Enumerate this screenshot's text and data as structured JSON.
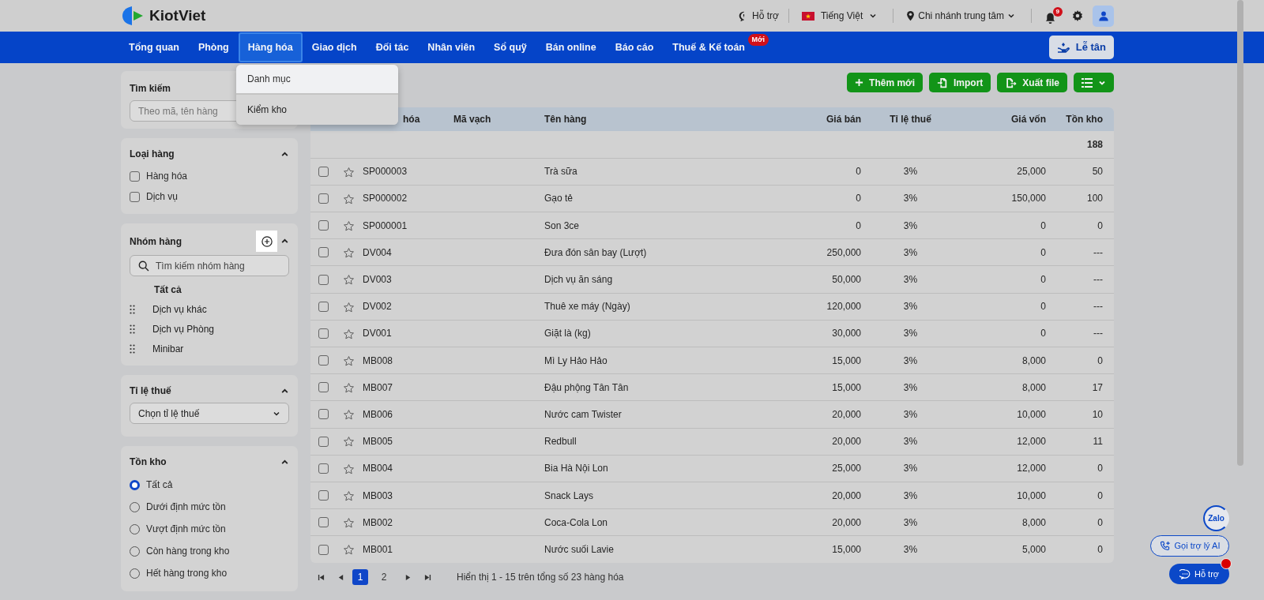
{
  "header": {
    "logo": "KiotViet",
    "support": "Hỗ trợ",
    "language": "Tiếng Việt",
    "branch": "Chi nhánh trung tâm",
    "notification_count": "9"
  },
  "nav": {
    "items": [
      {
        "label": "Tổng quan",
        "selected": false
      },
      {
        "label": "Phòng",
        "selected": false
      },
      {
        "label": "Hàng hóa",
        "selected": true
      },
      {
        "label": "Giao dịch",
        "selected": false
      },
      {
        "label": "Đối tác",
        "selected": false
      },
      {
        "label": "Nhân viên",
        "selected": false
      },
      {
        "label": "Sổ quỹ",
        "selected": false
      },
      {
        "label": "Bán online",
        "selected": false
      },
      {
        "label": "Báo cáo",
        "selected": false
      },
      {
        "label": "Thuế & Kế toán",
        "selected": false,
        "badge": "Mới"
      }
    ],
    "reception_button": "Lễ tân"
  },
  "dropdown": {
    "items": [
      {
        "label": "Danh mục",
        "selected": true
      },
      {
        "label": "Kiểm kho",
        "selected": false
      }
    ]
  },
  "sidebar": {
    "search": {
      "title": "Tìm kiếm",
      "placeholder": "Theo mã, tên hàng"
    },
    "product_type": {
      "title": "Loại hàng",
      "expanded": true,
      "options": [
        {
          "label": "Hàng hóa",
          "checked": false
        },
        {
          "label": "Dịch vụ",
          "checked": false
        }
      ]
    },
    "product_group": {
      "title": "Nhóm hàng",
      "expanded": true,
      "search_placeholder": "Tìm kiếm nhóm hàng",
      "items": [
        {
          "label": "Tất cả",
          "kind": "all",
          "selected": true
        },
        {
          "label": "Dịch vụ khác",
          "kind": "group",
          "selected": false
        },
        {
          "label": "Dịch vụ Phòng",
          "kind": "group",
          "selected": false
        },
        {
          "label": "Minibar",
          "kind": "group",
          "selected": false
        }
      ]
    },
    "tax_rate": {
      "title": "Tỉ lệ thuế",
      "expanded": true,
      "placeholder": "Chọn tỉ lệ thuế"
    },
    "stock": {
      "title": "Tồn kho",
      "expanded": true,
      "options": [
        {
          "label": "Tất cả",
          "selected": true
        },
        {
          "label": "Dưới định mức tồn",
          "selected": false
        },
        {
          "label": "Vượt định mức tồn",
          "selected": false
        },
        {
          "label": "Còn hàng trong kho",
          "selected": false
        },
        {
          "label": "Hết hàng trong kho",
          "selected": false
        }
      ]
    }
  },
  "toolbar": {
    "buttons": [
      {
        "label": "Thêm mới",
        "kind": "add"
      },
      {
        "label": "Import",
        "kind": "import"
      },
      {
        "label": "Xuất file",
        "kind": "export"
      }
    ]
  },
  "table": {
    "columns": [
      "hóa",
      "Mã vạch",
      "Tên hàng",
      "Giá bán",
      "Tỉ lệ thuế",
      "Giá vốn",
      "Tồn kho"
    ],
    "total_stock": "188",
    "rows": [
      {
        "code": "SP000003",
        "name": "Trà sữa",
        "price": "0",
        "tax": "3%",
        "cost": "25,000",
        "stock": "50",
        "checked": false,
        "starred": false
      },
      {
        "code": "SP000002",
        "name": "Gạo tẻ",
        "price": "0",
        "tax": "3%",
        "cost": "150,000",
        "stock": "100",
        "checked": false,
        "starred": false
      },
      {
        "code": "SP000001",
        "name": "Son 3ce",
        "price": "0",
        "tax": "3%",
        "cost": "0",
        "stock": "0",
        "checked": false,
        "starred": false
      },
      {
        "code": "DV004",
        "name": "Đưa đón sân bay (Lượt)",
        "price": "250,000",
        "tax": "3%",
        "cost": "0",
        "stock": "---",
        "checked": false,
        "starred": false
      },
      {
        "code": "DV003",
        "name": "Dịch vụ ăn sáng",
        "price": "50,000",
        "tax": "3%",
        "cost": "0",
        "stock": "---",
        "checked": false,
        "starred": false
      },
      {
        "code": "DV002",
        "name": "Thuê xe máy (Ngày)",
        "price": "120,000",
        "tax": "3%",
        "cost": "0",
        "stock": "---",
        "checked": false,
        "starred": false
      },
      {
        "code": "DV001",
        "name": "Giặt là (kg)",
        "price": "30,000",
        "tax": "3%",
        "cost": "0",
        "stock": "---",
        "checked": false,
        "starred": false
      },
      {
        "code": "MB008",
        "name": "Mì Ly Hảo Hảo",
        "price": "15,000",
        "tax": "3%",
        "cost": "8,000",
        "stock": "0",
        "checked": false,
        "starred": false
      },
      {
        "code": "MB007",
        "name": "Đậu phộng Tân Tân",
        "price": "15,000",
        "tax": "3%",
        "cost": "8,000",
        "stock": "17",
        "checked": false,
        "starred": false
      },
      {
        "code": "MB006",
        "name": "Nước cam Twister",
        "price": "20,000",
        "tax": "3%",
        "cost": "10,000",
        "stock": "10",
        "checked": false,
        "starred": false
      },
      {
        "code": "MB005",
        "name": "Redbull",
        "price": "20,000",
        "tax": "3%",
        "cost": "12,000",
        "stock": "11",
        "checked": false,
        "starred": false
      },
      {
        "code": "MB004",
        "name": "Bia Hà Nội Lon",
        "price": "25,000",
        "tax": "3%",
        "cost": "12,000",
        "stock": "0",
        "checked": false,
        "starred": false
      },
      {
        "code": "MB003",
        "name": "Snack Lays",
        "price": "20,000",
        "tax": "3%",
        "cost": "10,000",
        "stock": "0",
        "checked": false,
        "starred": false
      },
      {
        "code": "MB002",
        "name": "Coca-Cola Lon",
        "price": "20,000",
        "tax": "3%",
        "cost": "8,000",
        "stock": "0",
        "checked": false,
        "starred": false
      },
      {
        "code": "MB001",
        "name": "Nước suối Lavie",
        "price": "15,000",
        "tax": "3%",
        "cost": "5,000",
        "stock": "0",
        "checked": false,
        "starred": false
      }
    ]
  },
  "pagination": {
    "pages": [
      {
        "label": "1",
        "selected": true
      },
      {
        "label": "2",
        "selected": false
      }
    ],
    "info": "Hiển thị 1 - 15 trên tổng số 23 hàng hóa"
  },
  "floating": {
    "zalo": "Zalo",
    "ai_call": "Gọi trợ lý AI",
    "support": "Hỗ trợ"
  }
}
